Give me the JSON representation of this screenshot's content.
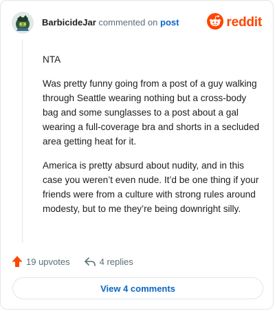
{
  "header": {
    "username": "BarbicideJar",
    "action_text": "commented on",
    "post_link": "post",
    "brand_name": "reddit",
    "avatar_icon": "user-avatar-icon",
    "brand_icon": "reddit-alien-icon"
  },
  "comment": {
    "paragraphs": [
      "NTA",
      "Was pretty funny going from a post of a guy walking through Seattle wearing nothing but a cross-body bag and some sunglasses to a post about a gal wearing a full-coverage bra and shorts in a secluded area getting heat for it.",
      "America is pretty absurd about nudity, and in this case you weren’t even nude. It’d be one thing if your friends were from a culture with strong rules around modesty, but to me they’re being downright silly."
    ]
  },
  "actions": {
    "upvotes_label": "19 upvotes",
    "replies_label": "4 replies",
    "upvote_icon": "upvote-arrow-icon",
    "reply_icon": "reply-arrow-icon"
  },
  "footer": {
    "view_comments_label": "View 4 comments"
  },
  "colors": {
    "brand": "#ff4500",
    "link": "#0a66c2",
    "muted": "#576f76",
    "border": "#e3e5e8"
  }
}
